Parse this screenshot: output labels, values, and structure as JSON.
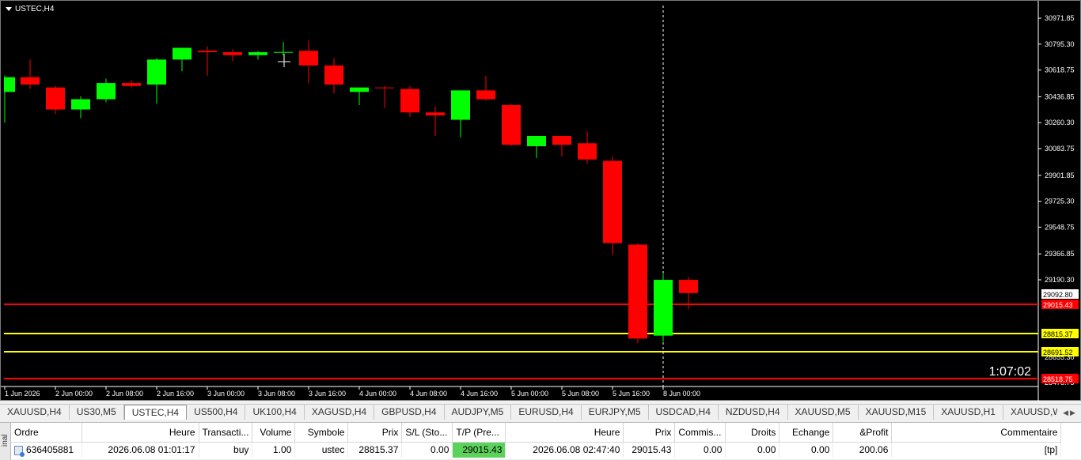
{
  "chart": {
    "symbol_label": "USTEC,H4",
    "countdown": "1:07:02",
    "colors": {
      "bull": "#00ff00",
      "bear": "#ff0000",
      "background": "#000000",
      "grid_text": "#ffffff",
      "line_red": "#ff0000",
      "line_yellow": "#ffff00"
    },
    "price_axis": [
      "30971.85",
      "30795.30",
      "30618.75",
      "30436.85",
      "30260.30",
      "30083.75",
      "29901.85",
      "29725.30",
      "29548.75",
      "29366.85",
      "29190.30"
    ],
    "time_axis": [
      "1 Jun 2026",
      "2 Jun 00:00",
      "2 Jun 08:00",
      "2 Jun 16:00",
      "3 Jun 00:00",
      "3 Jun 08:00",
      "3 Jun 16:00",
      "4 Jun 00:00",
      "4 Jun 08:00",
      "4 Jun 16:00",
      "5 Jun 00:00",
      "5 Jun 08:00",
      "5 Jun 16:00",
      "8 Jun 00:00"
    ],
    "price_axis_bottom_partial": [
      "28655.30",
      "28478.75"
    ],
    "current_price_label": "29092.80",
    "levels": [
      {
        "label": "29015.43",
        "color": "#ff0000",
        "text_color": "#ffffff"
      },
      {
        "label": "28815.37",
        "color": "#ffff00",
        "text_color": "#000000"
      },
      {
        "label": "28691.52",
        "color": "#ffff00",
        "text_color": "#000000"
      },
      {
        "label": "28518.75",
        "color": "#ff0000",
        "text_color": "#ffffff"
      }
    ],
    "candles": [
      {
        "o": 30470,
        "h": 30580,
        "l": 30260,
        "c": 30570
      },
      {
        "o": 30570,
        "h": 30690,
        "l": 30490,
        "c": 30520
      },
      {
        "o": 30500,
        "h": 30510,
        "l": 30320,
        "c": 30350
      },
      {
        "o": 30350,
        "h": 30440,
        "l": 30290,
        "c": 30420
      },
      {
        "o": 30420,
        "h": 30560,
        "l": 30400,
        "c": 30530
      },
      {
        "o": 30530,
        "h": 30550,
        "l": 30500,
        "c": 30510
      },
      {
        "o": 30520,
        "h": 30700,
        "l": 30390,
        "c": 30690
      },
      {
        "o": 30690,
        "h": 30770,
        "l": 30610,
        "c": 30770
      },
      {
        "o": 30750,
        "h": 30780,
        "l": 30580,
        "c": 30740
      },
      {
        "o": 30740,
        "h": 30760,
        "l": 30680,
        "c": 30720
      },
      {
        "o": 30720,
        "h": 30750,
        "l": 30690,
        "c": 30740
      },
      {
        "o": 30740,
        "h": 30810,
        "l": 30720,
        "c": 30742
      },
      {
        "o": 30750,
        "h": 30820,
        "l": 30530,
        "c": 30650
      },
      {
        "o": 30650,
        "h": 30700,
        "l": 30460,
        "c": 30520
      },
      {
        "o": 30470,
        "h": 30490,
        "l": 30380,
        "c": 30500
      },
      {
        "o": 30500,
        "h": 30510,
        "l": 30360,
        "c": 30497
      },
      {
        "o": 30490,
        "h": 30510,
        "l": 30300,
        "c": 30330
      },
      {
        "o": 30330,
        "h": 30370,
        "l": 30170,
        "c": 30310
      },
      {
        "o": 30280,
        "h": 30480,
        "l": 30160,
        "c": 30480
      },
      {
        "o": 30480,
        "h": 30580,
        "l": 30410,
        "c": 30420
      },
      {
        "o": 30380,
        "h": 30390,
        "l": 30100,
        "c": 30110
      },
      {
        "o": 30100,
        "h": 30170,
        "l": 30020,
        "c": 30170
      },
      {
        "o": 30170,
        "h": 30170,
        "l": 30030,
        "c": 30110
      },
      {
        "o": 30120,
        "h": 30200,
        "l": 29980,
        "c": 30010
      },
      {
        "o": 30000,
        "h": 30030,
        "l": 29360,
        "c": 29440
      },
      {
        "o": 29430,
        "h": 29440,
        "l": 28760,
        "c": 28790
      },
      {
        "o": 28810,
        "h": 29230,
        "l": 28770,
        "c": 29190
      },
      {
        "o": 29190,
        "h": 29210,
        "l": 28990,
        "c": 29100
      }
    ]
  },
  "tabs": [
    "XAUUSD,H4",
    "US30,M5",
    "USTEC,H4",
    "US500,H4",
    "UK100,H4",
    "XAGUSD,H4",
    "GBPUSD,H4",
    "AUDJPY,M5",
    "EURUSD,H4",
    "EURJPY,M5",
    "USDCAD,H4",
    "NZDUSD,H4",
    "XAUUSD,M5",
    "XAUUSD,M15",
    "XAUUSD,H1",
    "XAUUSD,Weekly"
  ],
  "active_tab": "USTEC,H4",
  "terminal": {
    "side_label": "inal",
    "headers": [
      "Ordre",
      "Heure",
      "Transacti...",
      "Volume",
      "Symbole",
      "Prix",
      "S/L (Sto...",
      "T/P (Pre...",
      "Heure",
      "Prix",
      "Commis...",
      "Droits",
      "Echange",
      "&Profit",
      "Commentaire"
    ],
    "row": {
      "ordre": "636405881",
      "heure_open": "2026.06.08 01:01:17",
      "type": "buy",
      "volume": "1.00",
      "symbole": "ustec",
      "prix_open": "28815.37",
      "sl": "0.00",
      "tp": "29015.43",
      "heure_current": "2026.06.08 02:47:40",
      "prix_current": "29015.43",
      "commission": "0.00",
      "droits": "0.00",
      "echange": "0.00",
      "profit": "200.06",
      "commentaire": "[tp]"
    }
  }
}
